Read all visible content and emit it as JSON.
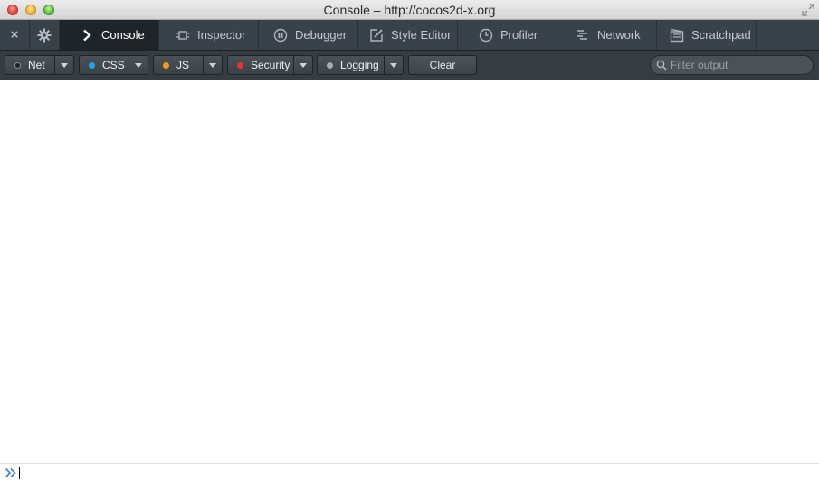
{
  "window": {
    "title": "Console – http://cocos2d-x.org"
  },
  "tabbar": {
    "close_glyph": "×",
    "tabs": [
      {
        "label": "Console",
        "icon": "chevron-right-icon",
        "active": true
      },
      {
        "label": "Inspector",
        "icon": "inspector-icon"
      },
      {
        "label": "Debugger",
        "icon": "pause-icon"
      },
      {
        "label": "Style Editor",
        "icon": "edit-icon"
      },
      {
        "label": "Profiler",
        "icon": "clock-icon"
      },
      {
        "label": "Network",
        "icon": "network-icon"
      },
      {
        "label": "Scratchpad",
        "icon": "scratchpad-icon"
      }
    ]
  },
  "toolbar": {
    "filters": [
      {
        "label": "Net",
        "dot_color": "#1f1f1f"
      },
      {
        "label": "CSS",
        "dot_color": "#1fa3e6"
      },
      {
        "label": "JS",
        "dot_color": "#f29a1d"
      },
      {
        "label": "Security",
        "dot_color": "#e5363b"
      },
      {
        "label": "Logging",
        "dot_color": "#a9adb0"
      }
    ],
    "clear_label": "Clear",
    "filter_placeholder": "Filter output"
  },
  "console": {
    "input_value": ""
  }
}
